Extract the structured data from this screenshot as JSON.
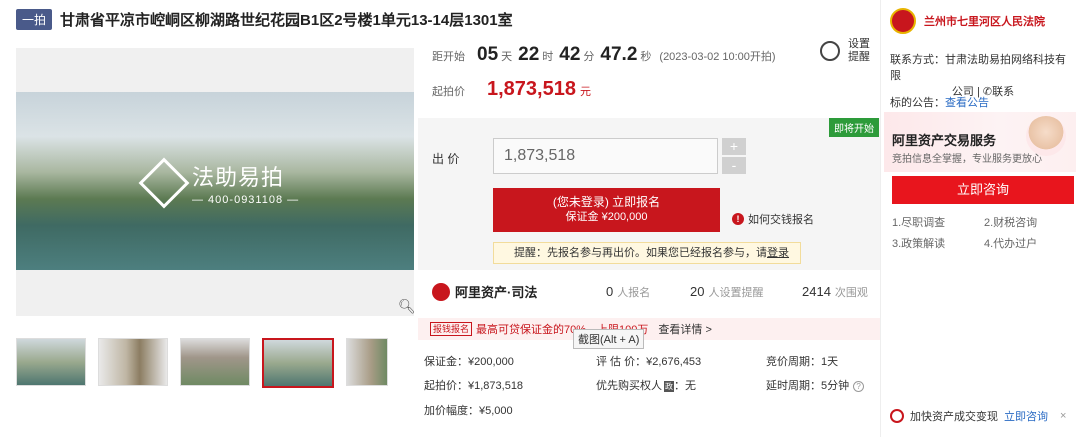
{
  "title": {
    "tag": "一拍",
    "text": "甘肃省平凉市崆峒区柳湖路世纪花园B1区2号楼1单元13-14层1301室"
  },
  "photo": {
    "watermark_brand": "法助易拍",
    "watermark_phone": "— 400-0931108 —"
  },
  "thumbs": [
    "thumb-1",
    "thumb-2",
    "thumb-3",
    "thumb-4",
    "thumb-5"
  ],
  "countdown": {
    "label": "距开始",
    "days": "05",
    "days_unit": "天",
    "hours": "22",
    "hours_unit": "时",
    "minutes": "42",
    "minutes_unit": "分",
    "seconds": "47.2",
    "seconds_unit": "秒",
    "start_note": "(2023-03-02 10:00开拍)"
  },
  "reminder": {
    "line1": "设置",
    "line2": "提醒"
  },
  "start_price": {
    "label": "起拍价",
    "value": "1,873,518",
    "unit": "元"
  },
  "bid": {
    "badge": "即将开始",
    "label": "出 价",
    "input_value": "1,873,518",
    "plus": "+",
    "minus": "-",
    "signup_line1": "(您未登录) 立即报名",
    "signup_line2": "保证金 ¥200,000",
    "howto": "如何交钱报名",
    "hint_text": "提醒：先报名参与再出价。如果您已经报名参与，请",
    "hint_link": "登录"
  },
  "stats": {
    "brand": "阿里资产·司法",
    "signups": "0",
    "signups_unit": "人报名",
    "reminders": "20",
    "reminders_unit": "人设置提醒",
    "views": "2414",
    "views_unit": "次围观"
  },
  "promo": {
    "badge": "报钱报名",
    "text": "最高可贷保证金的70%，上限100万",
    "more": "查看详情 >"
  },
  "tooltip": "截图(Alt + A)",
  "details": {
    "deposit": "保证金：¥200,000",
    "start": "起拍价：¥1,873,518",
    "increment": "加价幅度：¥5,000",
    "assessed": "评 估 价：¥2,676,453",
    "priority_label": "优先购买权人",
    "priority_badge": "政",
    "priority_value": "：无",
    "cycle": "竞价周期：1天",
    "delay": "延时周期：5分钟"
  },
  "sidebar": {
    "court": "兰州市七里河区人民法院",
    "contact_line1": "联系方式：甘肃法助易拍网络科技有限",
    "contact_line2": "公司",
    "contact_link": "联系",
    "notice_label": "标的公告：",
    "notice_link": "查看公告",
    "banner_title": "阿里资产交易服务",
    "banner_sub": "竞拍信息全掌握，专业服务更放心",
    "consult_button": "立即咨询",
    "services": [
      "1.尽职调查",
      "2.财税咨询",
      "3.政策解读",
      "4.代办过户"
    ],
    "speed_text": "加快资产成交变现",
    "speed_link": "立即咨询",
    "close": "×"
  },
  "colors": {
    "accent": "#c8161d",
    "link": "#2a6bc4",
    "soon_green": "#2d9b3a"
  }
}
